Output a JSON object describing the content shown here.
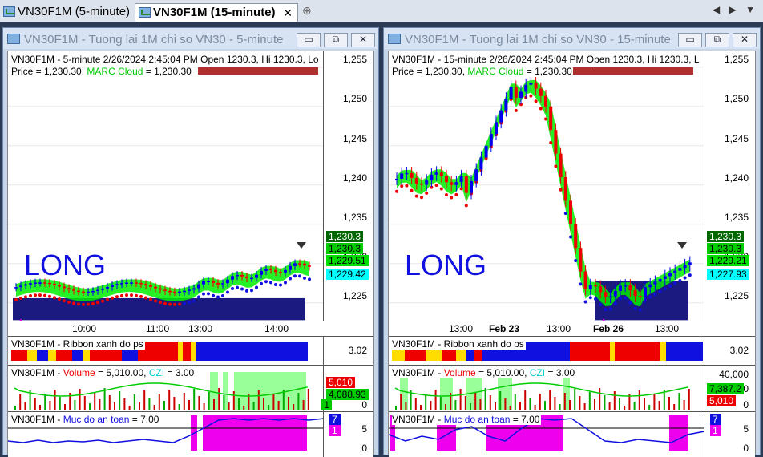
{
  "tabs": [
    {
      "label": "VN30F1M (5-minute)",
      "active": false
    },
    {
      "label": "VN30F1M (15-minute)",
      "active": true
    }
  ],
  "tab_close": "✕",
  "tab_add": "⊕",
  "nav_arrows": "◀ ▶ ▼",
  "window_buttons": {
    "minimize": "▭",
    "restore": "⧉",
    "close": "✕"
  },
  "windows": [
    {
      "title": "VN30F1M - Tuong lai 1M chi so VN30 - 5-minute",
      "info_line1": "VN30F1M - 5-minute 2/26/2024 2:45:04 PM Open 1230.3, Hi 1230.3, Lo",
      "price_label": "Price = 1,230.30,",
      "marc_label": "MARC Cloud",
      "marc_value": "= 1,230.30",
      "signal_text": "LONG",
      "y_ticks": [
        "1,255",
        "1,250",
        "1,245",
        "1,240",
        "1,235",
        "1,230",
        "1,225"
      ],
      "price_tags": [
        {
          "text": "1,230.3",
          "bg": "#006600",
          "fg": "#ffffff"
        },
        {
          "text": "1,230.3",
          "bg": "#00cc00",
          "fg": "#000000"
        },
        {
          "text": "1,229.51",
          "bg": "#00dd00",
          "fg": "#000000"
        },
        {
          "text": "1,229.42",
          "bg": "#00ffff",
          "fg": "#000000"
        }
      ],
      "x_ticks": [
        "10:00",
        "11:00",
        "13:00",
        "14:00"
      ],
      "ribbon_title": "VN30F1M - Ribbon xanh do ps",
      "ribbon_value": "3.02",
      "volume_title": "VN30F1M",
      "volume_label": "Volume",
      "volume_value": "= 5,010.00,",
      "czi_label": "CZI",
      "czi_value": "= 3.00",
      "volume_ticks": [
        "0"
      ],
      "volume_tags": [
        {
          "text": "5,010",
          "bg": "#ee0000",
          "fg": "#ffffff"
        },
        {
          "text": "4,088.93",
          "bg": "#00cc00",
          "fg": "#000000"
        }
      ],
      "volume_tag_small": "1",
      "safety_title": "VN30F1M",
      "safety_label": "Muc do an toan",
      "safety_value": "= 7.00",
      "safety_ticks": [
        "5",
        "0"
      ],
      "safety_tags": [
        {
          "text": "7",
          "bg": "#1010e0"
        },
        {
          "text": "1",
          "bg": "#ee00ee"
        }
      ]
    },
    {
      "title": "VN30F1M - Tuong lai 1M chi so VN30 - 15-minute",
      "info_line1": "VN30F1M - 15-minute 2/26/2024 2:45:04 PM Open 1230.3, Hi 1230.3, L",
      "price_label": "Price = 1,230.30,",
      "marc_label": "MARC Cloud",
      "marc_value": "= 1,230.30",
      "signal_text": "LONG",
      "y_ticks": [
        "1,255",
        "1,250",
        "1,245",
        "1,240",
        "1,235",
        "1,230",
        "1,225"
      ],
      "price_tags": [
        {
          "text": "1,230.3",
          "bg": "#006600",
          "fg": "#ffffff"
        },
        {
          "text": "1,230.3",
          "bg": "#00cc00",
          "fg": "#000000"
        },
        {
          "text": "1,229.21",
          "bg": "#00dd00",
          "fg": "#000000"
        },
        {
          "text": "1,227.93",
          "bg": "#00ffff",
          "fg": "#000000"
        }
      ],
      "x_ticks": [
        "13:00",
        "Feb 23",
        "13:00",
        "Feb 26",
        "13:00"
      ],
      "ribbon_title": "VN30F1M - Ribbon xanh do ps",
      "ribbon_value": "3.02",
      "volume_title": "VN30F1M",
      "volume_label": "Volume",
      "volume_value": "= 5,010.00,",
      "czi_label": "CZI",
      "czi_value": "= 3.00",
      "volume_ticks": [
        "40,000",
        "20,000",
        "0"
      ],
      "volume_tags": [
        {
          "text": "7,387.2",
          "bg": "#00cc00",
          "fg": "#000000"
        },
        {
          "text": "5,010",
          "bg": "#ee0000",
          "fg": "#ffffff"
        }
      ],
      "volume_tag_small": "",
      "safety_title": "VN30F1M",
      "safety_label": "Muc do an toan",
      "safety_value": "= 7.00",
      "safety_ticks": [
        "5",
        "0"
      ],
      "safety_tags": [
        {
          "text": "7",
          "bg": "#1010e0"
        },
        {
          "text": "1",
          "bg": "#ee00ee"
        }
      ]
    }
  ],
  "colors": {
    "up_candle": "#0000ee",
    "down_candle": "#ee0000",
    "cloud_green": "#00ee00",
    "cloud_yellow": "#ffff00",
    "trail_red": "#ee0000",
    "trail_blue": "#1010e0",
    "zone_navy": "#1a1a80",
    "resistance_bar": "#b03030",
    "volume_bg": "#99ff99",
    "volume_line": "#00cc00",
    "czi_line": "#ee00ee",
    "safety_line": "#1010e0",
    "safety_fill": "#ee00ee"
  }
}
